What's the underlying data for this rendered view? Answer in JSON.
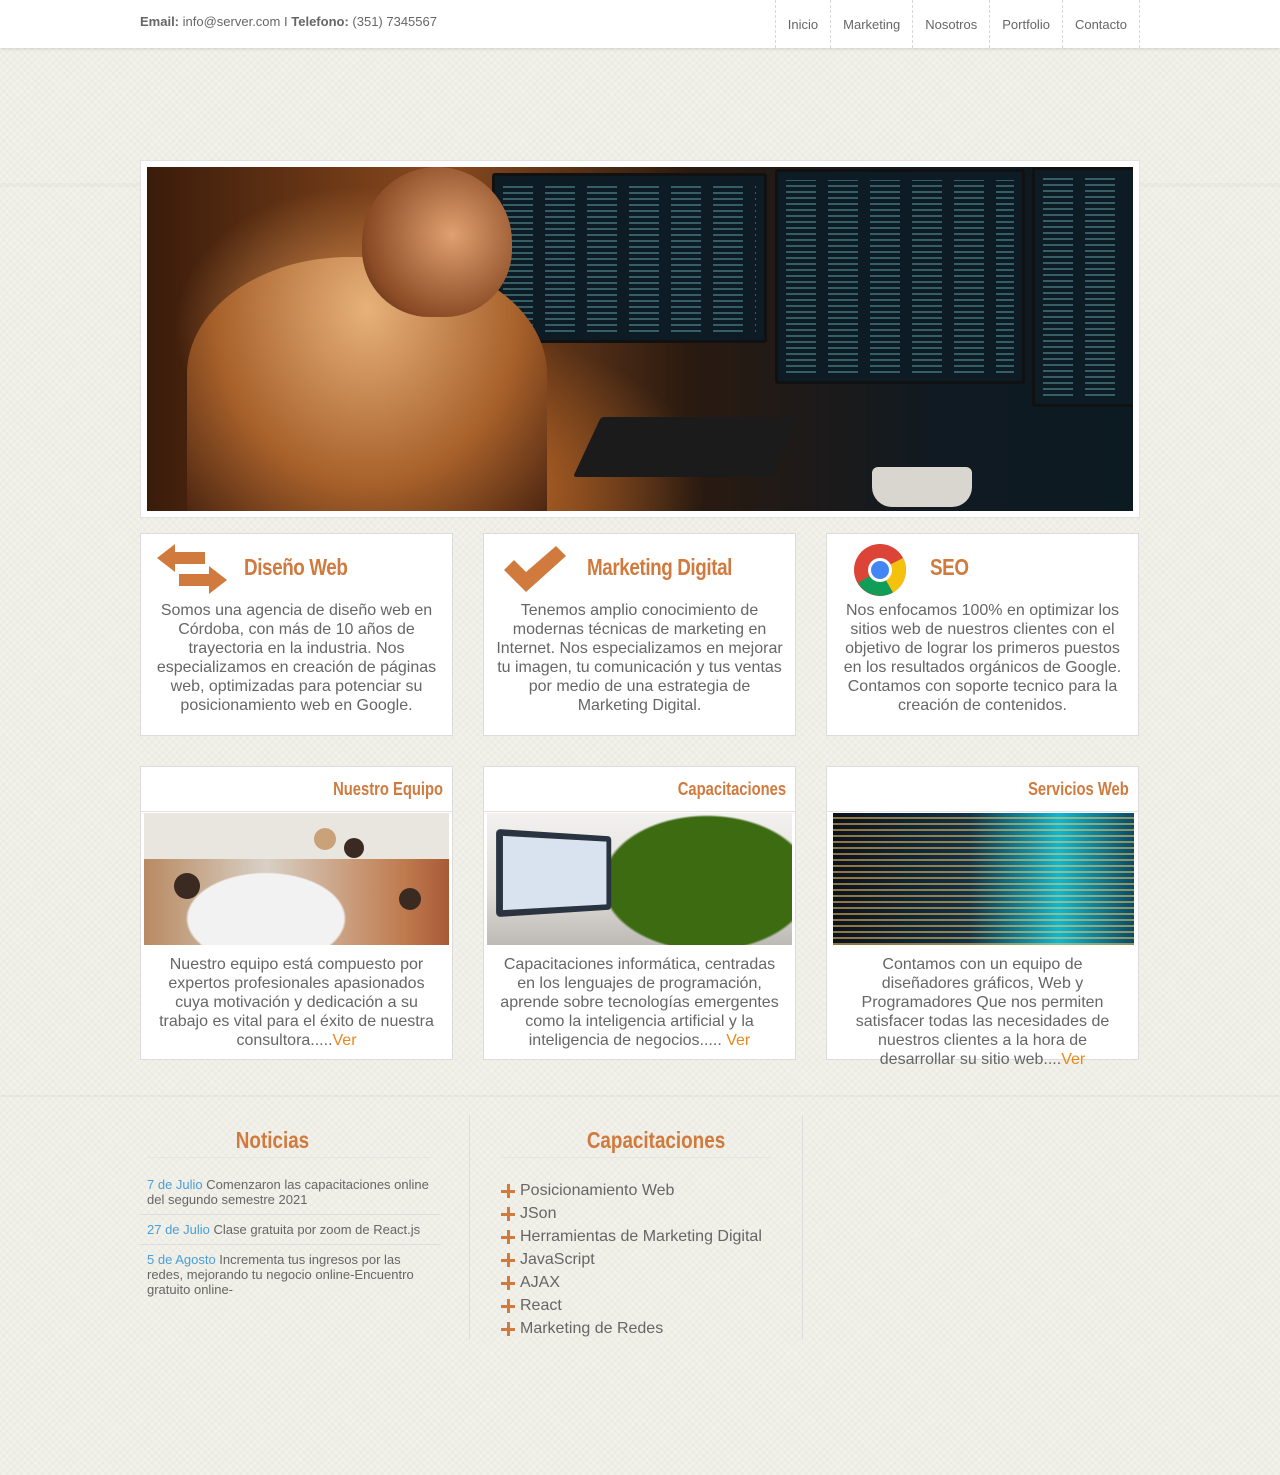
{
  "header": {
    "email_label": "Email:",
    "email_value": "info@server.com",
    "separator": "I",
    "phone_label": "Telefono:",
    "phone_value": "(351) 7345567",
    "nav": [
      "Inicio",
      "Marketing",
      "Nosotros",
      "Portfolio",
      "Contacto"
    ]
  },
  "services": [
    {
      "title": "Diseño Web",
      "icon": "swap-arrows-icon",
      "text": "Somos una agencia de diseño web en Córdoba, con más de 10 años de trayectoria en la industria. Nos especializamos en creación de páginas web, optimizadas para potenciar su posicionamiento web en Google."
    },
    {
      "title": "Marketing Digital",
      "icon": "checkmark-icon",
      "text": "Tenemos amplio conocimiento de modernas técnicas de marketing en Internet. Nos especializamos en mejorar tu imagen, tu comunicación y tus ventas por medio de una estrategia de Marketing Digital."
    },
    {
      "title": "SEO",
      "icon": "chrome-icon",
      "text": "Nos enfocamos 100% en optimizar los sitios web de nuestros clientes con el objetivo de lograr los primeros puestos en los resultados orgánicos de Google. Contamos con soporte tecnico para la creación de contenidos."
    }
  ],
  "features": [
    {
      "title": "Nuestro Equipo",
      "text": "Nuestro equipo está compuesto por expertos profesionales apasionados cuya motivación y dedicación a su trabajo es vital para el éxito de nuestra consultora.....",
      "link": "Ver"
    },
    {
      "title": "Capacitaciones",
      "text": "Capacitaciones informática, centradas en los lenguajes de programación, aprende sobre tecnologías emergentes como la inteligencia artificial y la inteligencia de negocios..... ",
      "link": "Ver"
    },
    {
      "title": "Servicios Web",
      "text": "Contamos con un equipo de diseñadores gráficos, Web y Programadores Que nos permiten satisfacer todas las necesidades de nuestros clientes a la hora de desarrollar su sitio web....",
      "link": "Ver"
    }
  ],
  "news": {
    "title": "Noticias",
    "items": [
      {
        "date": "7 de Julio",
        "text": "Comenzaron las capacitaciones online del segundo semestre 2021"
      },
      {
        "date": "27 de Julio",
        "text": "Clase gratuita por zoom de React.js"
      },
      {
        "date": "5 de Agosto",
        "text": "Incrementa tus ingresos por las redes, mejorando tu negocio online-Encuentro gratuito online-"
      }
    ]
  },
  "courses": {
    "title": "Capacitaciones",
    "items": [
      "Posicionamiento Web",
      "JSon",
      "Herramientas de Marketing Digital",
      "JavaScript",
      "AJAX",
      "React",
      "Marketing de Redes"
    ]
  },
  "colors": {
    "accent": "#d17a3e",
    "link_orange": "#e8891d",
    "date_blue": "#4a9fd9"
  }
}
